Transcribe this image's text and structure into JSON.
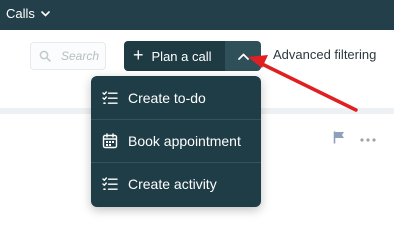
{
  "topbar": {
    "title": "Calls",
    "icon": "chevron-down-icon"
  },
  "toolbar": {
    "search_placeholder": "Search",
    "plan_label": "Plan a call",
    "plan_icon": "plus-icon",
    "toggle_icon": "chevron-up-icon",
    "advanced_label": "Advanced filtering"
  },
  "menu": {
    "items": [
      {
        "label": "Create to-do",
        "icon": "checklist-icon"
      },
      {
        "label": "Book appointment",
        "icon": "calendar-icon"
      },
      {
        "label": "Create activity",
        "icon": "checklist-icon"
      }
    ]
  },
  "row_actions": {
    "flag_icon": "flag-icon",
    "more_icon": "more-icon"
  },
  "colors": {
    "topbar": "#23404a",
    "button": "#1e3a43",
    "menu_bg": "#1f3d46",
    "annotation": "#e02020"
  }
}
